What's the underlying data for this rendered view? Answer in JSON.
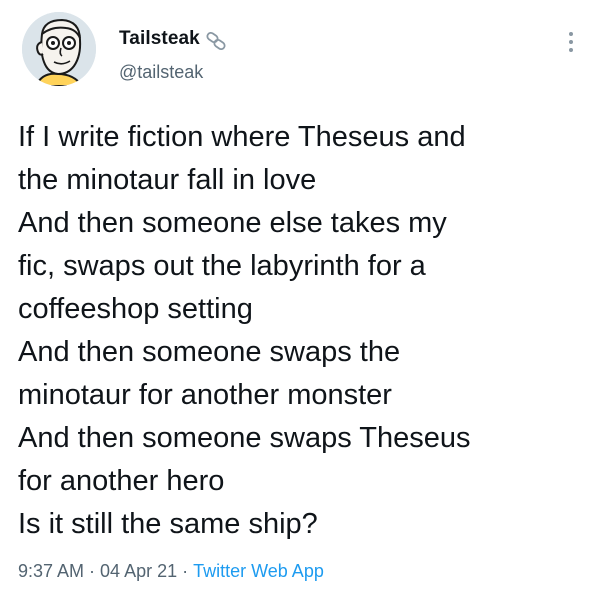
{
  "user": {
    "display_name": "Tailsteak",
    "handle": "@tailsteak",
    "avatar_icon": "cartoon-face-avatar",
    "badge_icon": "chain-link-icon"
  },
  "menu": {
    "icon": "more-vertical-icon"
  },
  "tweet": {
    "lines": [
      "If I write fiction where Theseus and",
      "the minotaur fall in love",
      "And then someone else takes my",
      "fic, swaps out the labyrinth for a",
      "coffeeshop setting",
      "And then someone swaps the",
      "minotaur for another monster",
      "And then someone swaps Theseus",
      "for another hero",
      "Is it still the same ship?"
    ]
  },
  "meta": {
    "time": "9:37 AM",
    "separator": "·",
    "date": "04 Apr 21",
    "source": "Twitter Web App"
  },
  "colors": {
    "text": "#0f1419",
    "secondary": "#536471",
    "link": "#1d9bf0"
  }
}
